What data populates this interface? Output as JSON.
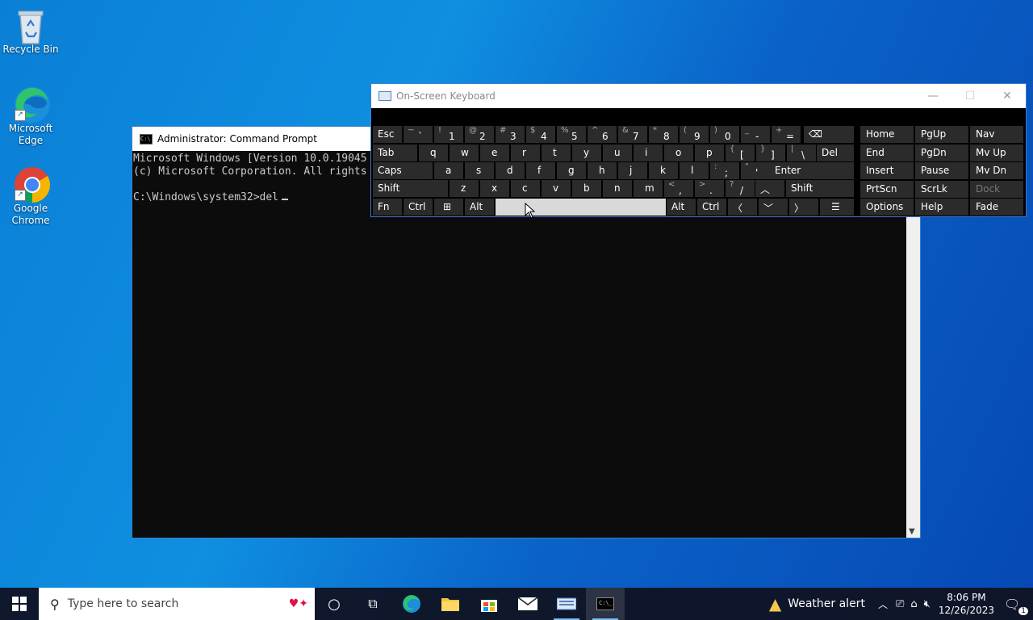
{
  "desktop": {
    "icons": [
      {
        "label": "Recycle Bin"
      },
      {
        "label": "Microsoft Edge"
      },
      {
        "label": "Google Chrome"
      }
    ]
  },
  "cmd": {
    "title": "Administrator: Command Prompt",
    "lines": [
      "Microsoft Windows [Version 10.0.19045",
      "(c) Microsoft Corporation. All rights",
      "",
      "C:\\Windows\\system32>del"
    ]
  },
  "osk": {
    "title": "On-Screen Keyboard",
    "keys": {
      "esc": "Esc",
      "tab": "Tab",
      "caps": "Caps",
      "shift_l": "Shift",
      "fn": "Fn",
      "ctrl_l": "Ctrl",
      "alt_l": "Alt",
      "alt_r": "Alt",
      "ctrl_r": "Ctrl",
      "del": "Del",
      "enter": "Enter",
      "shift_r": "Shift",
      "row1": [
        [
          "~",
          "`"
        ],
        [
          "!",
          "1"
        ],
        [
          "@",
          "2"
        ],
        [
          "#",
          "3"
        ],
        [
          "$",
          "4"
        ],
        [
          "%",
          "5"
        ],
        [
          "^",
          "6"
        ],
        [
          "&",
          "7"
        ],
        [
          "*",
          "8"
        ],
        [
          "(",
          "9"
        ],
        [
          ")",
          "0"
        ],
        [
          "_",
          "-"
        ],
        [
          "+",
          "="
        ]
      ],
      "row2": [
        "q",
        "w",
        "e",
        "r",
        "t",
        "y",
        "u",
        "i",
        "o",
        "p"
      ],
      "row2b": [
        [
          "{",
          "["
        ],
        [
          "}",
          "]"
        ],
        [
          "|",
          "\\"
        ]
      ],
      "row3": [
        "a",
        "s",
        "d",
        "f",
        "g",
        "h",
        "j",
        "k",
        "l"
      ],
      "row3b": [
        [
          ":",
          ";"
        ],
        [
          "\"",
          "'"
        ]
      ],
      "row4": [
        "z",
        "x",
        "c",
        "v",
        "b",
        "n",
        "m"
      ],
      "row4b": [
        [
          "<",
          ","
        ],
        [
          ">",
          "."
        ],
        [
          "?",
          "/"
        ]
      ]
    },
    "right_keys": [
      [
        "Home",
        "PgUp",
        "Nav"
      ],
      [
        "End",
        "PgDn",
        "Mv Up"
      ],
      [
        "Insert",
        "Pause",
        "Mv Dn"
      ],
      [
        "PrtScn",
        "ScrLk",
        "Dock"
      ],
      [
        "Options",
        "Help",
        "Fade"
      ]
    ]
  },
  "taskbar": {
    "search_placeholder": "Type here to search",
    "weather": "Weather alert",
    "time": "8:06 PM",
    "date": "12/26/2023",
    "notifications": "1"
  }
}
